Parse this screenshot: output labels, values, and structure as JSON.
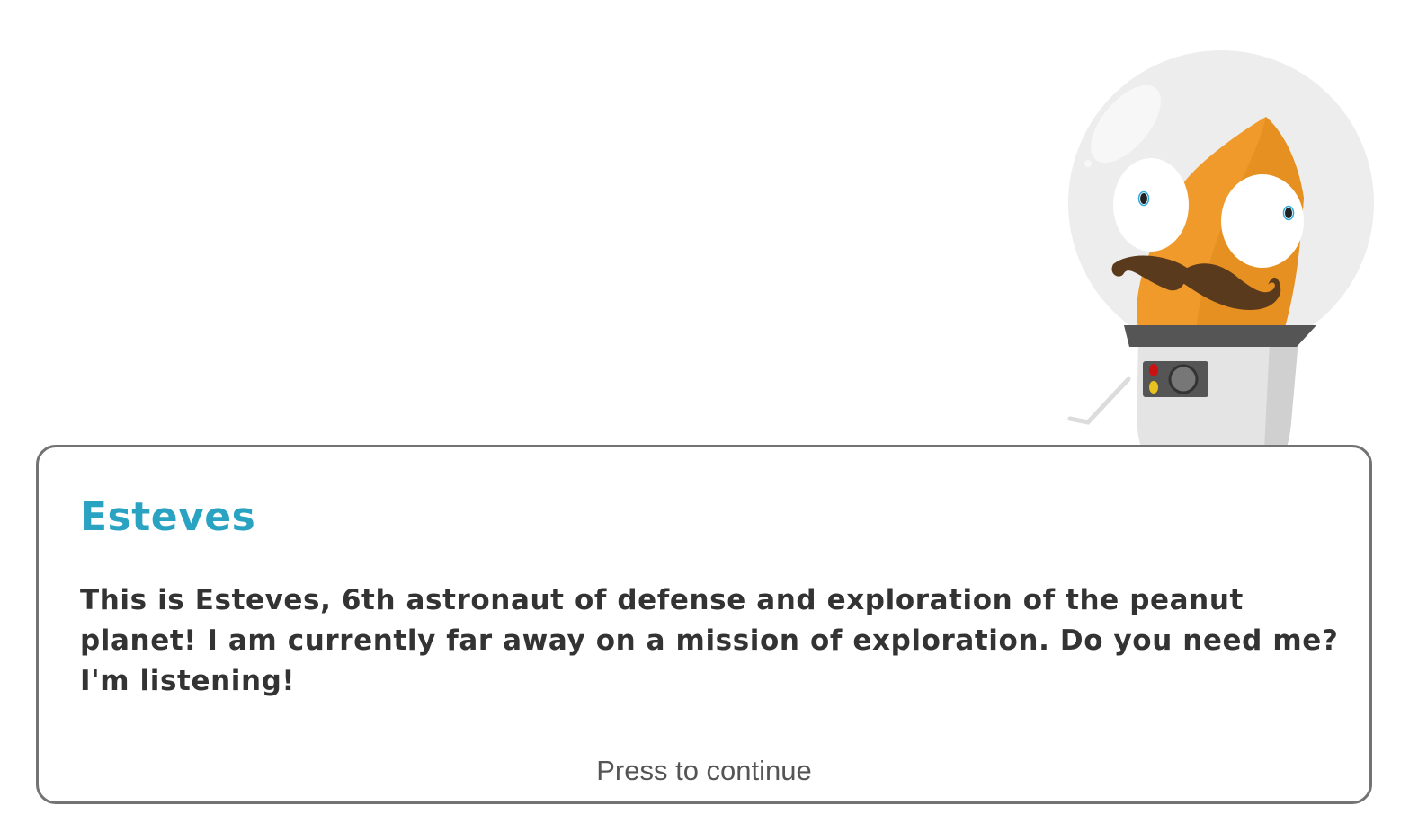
{
  "character": {
    "icon": "astronaut-mascot-icon",
    "colors": {
      "helmet": "#ececec",
      "face": "#ef9a2a",
      "mustache": "#5a3a1c",
      "collar": "#555555"
    }
  },
  "dialog": {
    "speaker_name": "Esteves",
    "message": "This is Esteves, 6th astronaut of defense and exploration of the peanut planet! I am currently far away on a mission of exploration. Do you need me? I'm listening!",
    "continue_label": "Press to continue",
    "colors": {
      "speaker": "#2aa3c2",
      "border": "#737373",
      "text": "#333333"
    }
  }
}
